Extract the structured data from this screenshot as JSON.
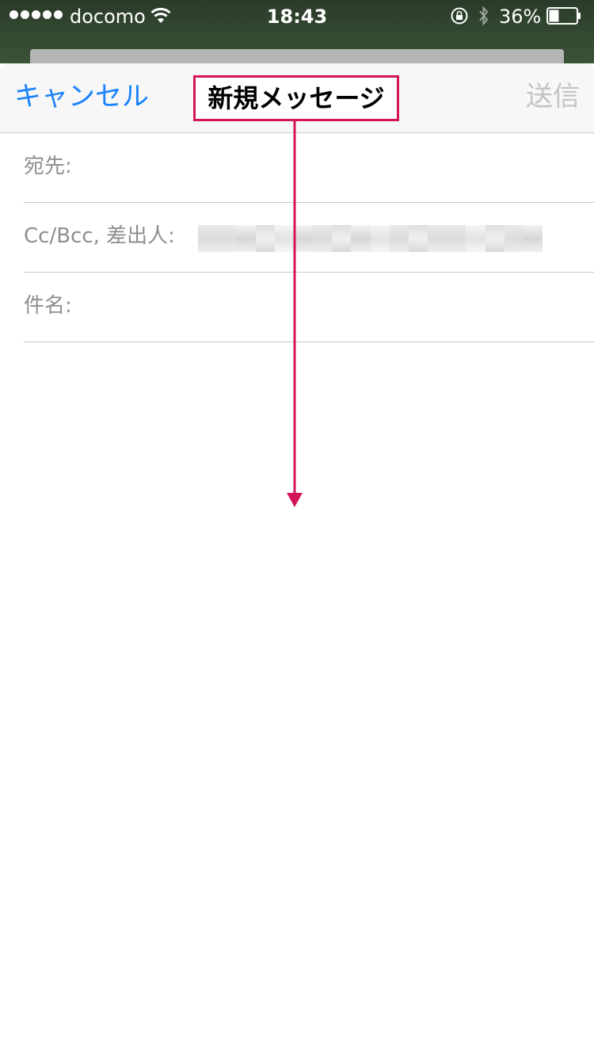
{
  "status_bar": {
    "carrier": "docomo",
    "time": "18:43",
    "battery_percent": "36%",
    "battery_level": 0.36
  },
  "nav": {
    "cancel_label": "キャンセル",
    "title": "新規メッセージ",
    "send_label": "送信"
  },
  "form": {
    "to_label": "宛先:",
    "cc_label": "Cc/Bcc, 差出人:",
    "subject_label": "件名:"
  },
  "colors": {
    "accent": "#1a82fb",
    "annotation": "#d4145a",
    "disabled": "#c4c4c4"
  },
  "icons": [
    "signal-dots-icon",
    "wifi-icon",
    "rotation-lock-icon",
    "bluetooth-icon",
    "battery-icon"
  ]
}
